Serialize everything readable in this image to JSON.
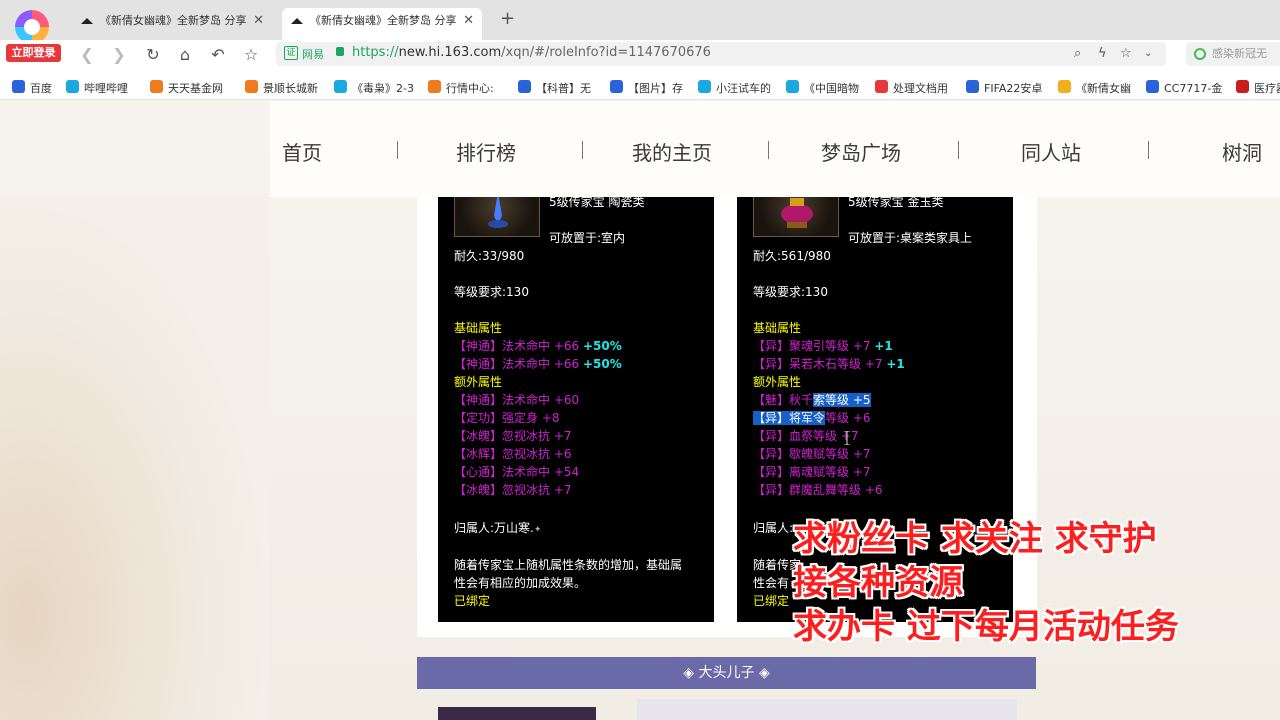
{
  "browser": {
    "login_label": "立即登录",
    "tabs": [
      {
        "title": "《新倩女幽魂》全新梦岛 分享"
      },
      {
        "title": "《新倩女幽魂》全新梦岛 分享"
      }
    ],
    "new_tab_symbol": "+",
    "address": {
      "security_label": "网易",
      "url_scheme": "https://",
      "url_host": "new.hi.163.com",
      "url_path": "/xqn/#/roleInfo?id=1147670676"
    },
    "search_placeholder": "感染新冠无"
  },
  "bookmarks": [
    {
      "label": "百度",
      "color": "#2a62d9"
    },
    {
      "label": "哔哩哔哩",
      "color": "#1aa8e0"
    },
    {
      "label": "天天基金网",
      "color": "#f07a1e"
    },
    {
      "label": "景顺长城新",
      "color": "#f07a1e"
    },
    {
      "label": "《毒枭》2-3",
      "color": "#1aa8e0"
    },
    {
      "label": "行情中心:",
      "color": "#f07a1e"
    },
    {
      "label": "【科普】无",
      "color": "#2a62d9"
    },
    {
      "label": "【图片】存",
      "color": "#2a62d9"
    },
    {
      "label": "小汪试车的",
      "color": "#1aa8e0"
    },
    {
      "label": "《中国暗物",
      "color": "#1aa8e0"
    },
    {
      "label": "处理文档用",
      "color": "#e8383d"
    },
    {
      "label": "FIFA22安卓",
      "color": "#2a62d9"
    },
    {
      "label": "《新倩女幽",
      "color": "#f0b01e"
    },
    {
      "label": "CC7717-金",
      "color": "#2a62d9"
    },
    {
      "label": "医疗器",
      "color": "#c81e1e"
    }
  ],
  "nav": {
    "items": [
      "首页",
      "排行榜",
      "我的主页",
      "梦岛广场",
      "同人站",
      "树洞"
    ]
  },
  "cards": [
    {
      "type_line": "5级传家宝 陶瓷类",
      "place_line": "可放置于:室内",
      "durability": "耐久:33/980",
      "level_req": "等级要求:130",
      "base_title": "基础属性",
      "base_attrs": [
        {
          "text": "【神通】法术命中 +66",
          "bonus": "+50%"
        },
        {
          "text": "【神通】法术命中 +66",
          "bonus": "+50%"
        }
      ],
      "extra_title": "额外属性",
      "extra_attrs": [
        "【神通】法术命中 +60",
        "【定功】强定身 +8",
        "【冰魄】忽视冰抗 +7",
        "【冰辉】忽视冰抗 +6",
        "【心通】法术命中 +54",
        "【冰魄】忽视冰抗 +7"
      ],
      "owner": "归属人:万山寒.",
      "owner_mark": "✦",
      "desc1": "随着传家宝上随机属性条数的增加，基础属",
      "desc2": "性会有相应的加成效果。",
      "bound": "已绑定"
    },
    {
      "type_line": "5级传家宝 金玉类",
      "place_line": "可放置于:桌案类家具上",
      "durability": "耐久:561/980",
      "level_req": "等级要求:130",
      "base_title": "基础属性",
      "base_attrs": [
        {
          "text": "【异】聚魂引等级 +7",
          "bonus": "+1"
        },
        {
          "text": "【异】呆若木石等级 +7",
          "bonus": "+1"
        }
      ],
      "extra_title": "额外属性",
      "extra_attrs": [
        {
          "pre": "【魅】秋千",
          "hl": "索等级 +5",
          "post": ""
        },
        {
          "pre": "",
          "hl": "【异】将军令",
          "post": "等级 +6"
        },
        {
          "pre": "【异】血祭等级",
          "hl": "",
          "post": " +7"
        },
        {
          "pre": "【异】歇魄赋等级 +7",
          "hl": "",
          "post": ""
        },
        {
          "pre": "【异】离魂赋等级 +7",
          "hl": "",
          "post": ""
        },
        {
          "pre": "【异】群魔乱舞等级 +6",
          "hl": "",
          "post": ""
        }
      ],
      "owner": "归属人:",
      "desc1": "随着传家",
      "desc2": "性会有",
      "bound": "已绑定"
    }
  ],
  "banner": {
    "left_mark": "◈",
    "name": "大头儿子",
    "right_mark": "◈"
  },
  "overlay": {
    "line1": "求粉丝卡  求关注  求守护",
    "line2": "接各种资源",
    "line3": "求办卡 过下每月活动任务"
  },
  "colors": {
    "overlay": "#ff1e1e",
    "banner": "#6a6aa8",
    "accent_green": "#1ea55f"
  }
}
